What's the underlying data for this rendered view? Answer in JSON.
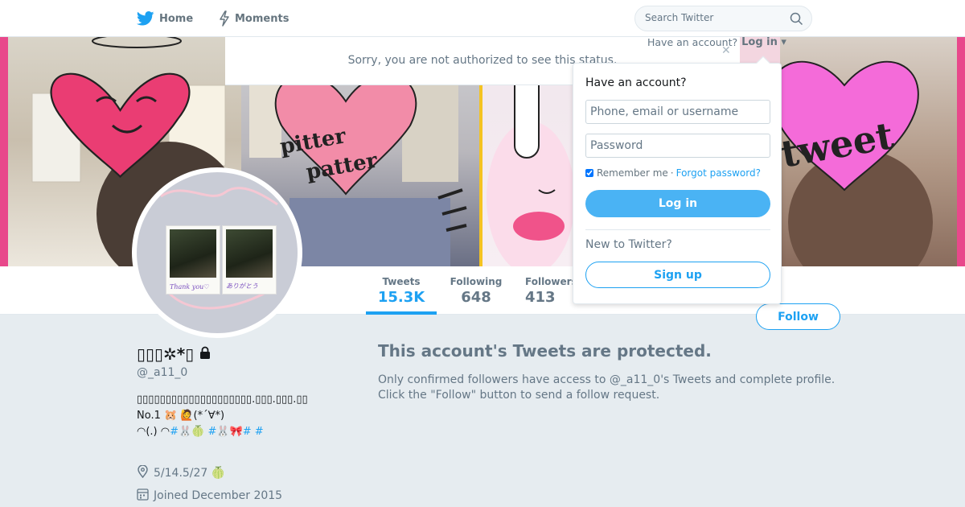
{
  "nav": {
    "home_label": "Home",
    "moments_label": "Moments",
    "search_placeholder": "Search Twitter"
  },
  "account_bar": {
    "have_account": "Have an account?",
    "login_label": "Log in ▾"
  },
  "notice": {
    "sorry_text": "Sorry, you are not authorized to see this status."
  },
  "banner": {
    "words": [
      "pitter",
      "patter",
      "tweet"
    ]
  },
  "avatar": {
    "caption_left": "Thank you♡",
    "caption_right": "ありがとう"
  },
  "stats": {
    "tweets_label": "Tweets",
    "tweets_value": "15.3K",
    "following_label": "Following",
    "following_value": "648",
    "followers_label": "Followers",
    "followers_value": "413"
  },
  "follow_label": "Follow",
  "profile": {
    "name": "▯▯▯✲*▯",
    "handle": "@_a11_0",
    "bio_line1": "▯▯▯▯▯▯▯▯▯▯▯▯▯▯▯▯▯▯▯▯.▯▯▯.▯▯▯.▯▯",
    "bio_line2": "No.1          🐹        🙋(*´∀*)",
    "bio_line3": "             ◠(.)      ◠",
    "bio_hashtags": "#🐰🍈 #🐰🎀#    #",
    "location": "5/14.5/27    🍈",
    "joined": "Joined December 2015"
  },
  "protected": {
    "title": "This account's Tweets are protected.",
    "desc": "Only confirmed followers have access to @_a11_0's Tweets and complete profile. Click the \"Follow\" button to send a follow request."
  },
  "login_dropdown": {
    "heading": "Have an account?",
    "username_placeholder": "Phone, email or username",
    "password_placeholder": "Password",
    "remember_label": "Remember me",
    "separator": "·",
    "forgot_label": "Forgot password?",
    "login_button": "Log in",
    "new_to": "New to Twitter?",
    "signup_button": "Sign up"
  },
  "colors": {
    "accent": "#1da1f2",
    "login_btn": "#4ab3f4",
    "banner_edge": "#e8488b"
  }
}
